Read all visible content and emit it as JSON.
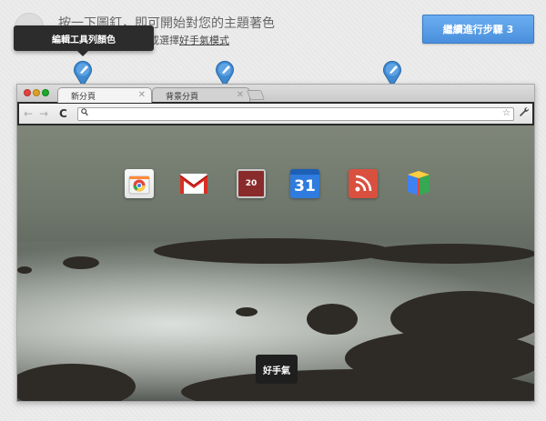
{
  "header": {
    "headline": "按一下圖釘，即可開始對您的主題著色",
    "subline_prefix": "或選擇",
    "subline_link": "好手氣模式"
  },
  "continue_button": {
    "label": "繼續進行步驟 3"
  },
  "tooltip": {
    "text": "編輯工具列顏色"
  },
  "pins": [
    {
      "name": "toolbar-color-pin"
    },
    {
      "name": "tab-color-pin"
    },
    {
      "name": "frame-color-pin"
    }
  ],
  "browser": {
    "tabs": [
      {
        "label": "新分頁",
        "close": "✕"
      },
      {
        "label": "背景分頁",
        "close": "✕"
      }
    ],
    "toolbar": {
      "back": "←",
      "forward": "→",
      "reload": "C",
      "star": "☆",
      "wrench": "🔧"
    }
  },
  "apps": [
    {
      "name": "chrome-web-store-app",
      "label": ""
    },
    {
      "name": "gmail-app",
      "label": ""
    },
    {
      "name": "calendar-red-app",
      "label": "20"
    },
    {
      "name": "google-calendar-app",
      "label": "31"
    },
    {
      "name": "rss-reader-app",
      "label": ""
    },
    {
      "name": "book-app",
      "label": ""
    }
  ],
  "theme_badge": {
    "text": "好手氣"
  },
  "colors": {
    "button_blue": "#4a8fdc",
    "tooltip_bg": "#2c2c2c",
    "pin_blue": "#3f8ad0"
  }
}
